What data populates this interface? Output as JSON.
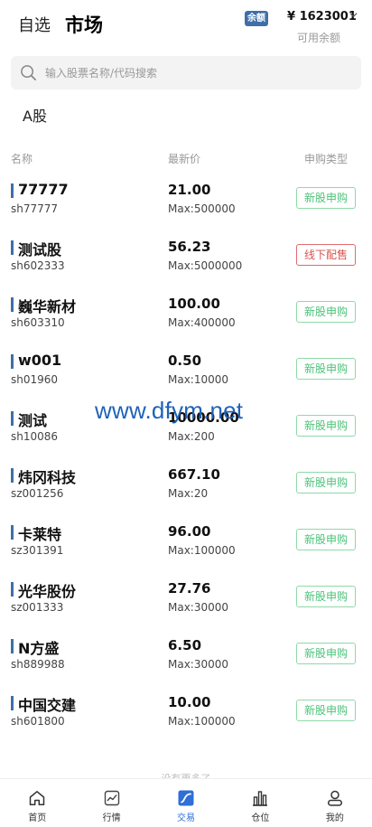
{
  "header": {
    "tab_watchlist": "自选",
    "tab_market": "市场",
    "balance_badge": "余额",
    "balance_amount": "¥ 1623001",
    "balance_label": "可用余额"
  },
  "search": {
    "placeholder": "输入股票名称/代码搜索"
  },
  "section": "A股",
  "columns": {
    "name": "名称",
    "price": "最新价",
    "type": "申购类型"
  },
  "stocks": [
    {
      "name": "77777",
      "code": "sh77777",
      "price": "21.00",
      "max": "Max:500000",
      "type": "新股申购",
      "type_color": "#4cc37a"
    },
    {
      "name": "测试股",
      "code": "sh602333",
      "price": "56.23",
      "max": "Max:5000000",
      "type": "线下配售",
      "type_color": "#d9534f"
    },
    {
      "name": "巍华新材",
      "code": "sh603310",
      "price": "100.00",
      "max": "Max:400000",
      "type": "新股申购",
      "type_color": "#4cc37a"
    },
    {
      "name": "w001",
      "code": "sh01960",
      "price": "0.50",
      "max": "Max:10000",
      "type": "新股申购",
      "type_color": "#4cc37a"
    },
    {
      "name": "测试",
      "code": "sh10086",
      "price": "10000.00",
      "max": "Max:200",
      "type": "新股申购",
      "type_color": "#4cc37a"
    },
    {
      "name": "炜冈科技",
      "code": "sz001256",
      "price": "667.10",
      "max": "Max:20",
      "type": "新股申购",
      "type_color": "#4cc37a"
    },
    {
      "name": "卡莱特",
      "code": "sz301391",
      "price": "96.00",
      "max": "Max:100000",
      "type": "新股申购",
      "type_color": "#4cc37a"
    },
    {
      "name": "光华股份",
      "code": "sz001333",
      "price": "27.76",
      "max": "Max:30000",
      "type": "新股申购",
      "type_color": "#4cc37a"
    },
    {
      "name": "N方盛",
      "code": "sh889988",
      "price": "6.50",
      "max": "Max:30000",
      "type": "新股申购",
      "type_color": "#4cc37a"
    },
    {
      "name": "中国交建",
      "code": "sh601800",
      "price": "10.00",
      "max": "Max:100000",
      "type": "新股申购",
      "type_color": "#4cc37a"
    }
  ],
  "watermark": "www.dfym.net",
  "no_more": "没有更多了",
  "tabbar": [
    {
      "label": "首页",
      "icon": "home-icon"
    },
    {
      "label": "行情",
      "icon": "chart-icon"
    },
    {
      "label": "交易",
      "icon": "trade-icon",
      "active": true
    },
    {
      "label": "仓位",
      "icon": "position-icon"
    },
    {
      "label": "我的",
      "icon": "user-icon"
    }
  ],
  "colors": {
    "accent": "#3f6fa8",
    "active_tab": "#2f6fd6",
    "green": "#4cc37a",
    "red": "#d9534f"
  }
}
